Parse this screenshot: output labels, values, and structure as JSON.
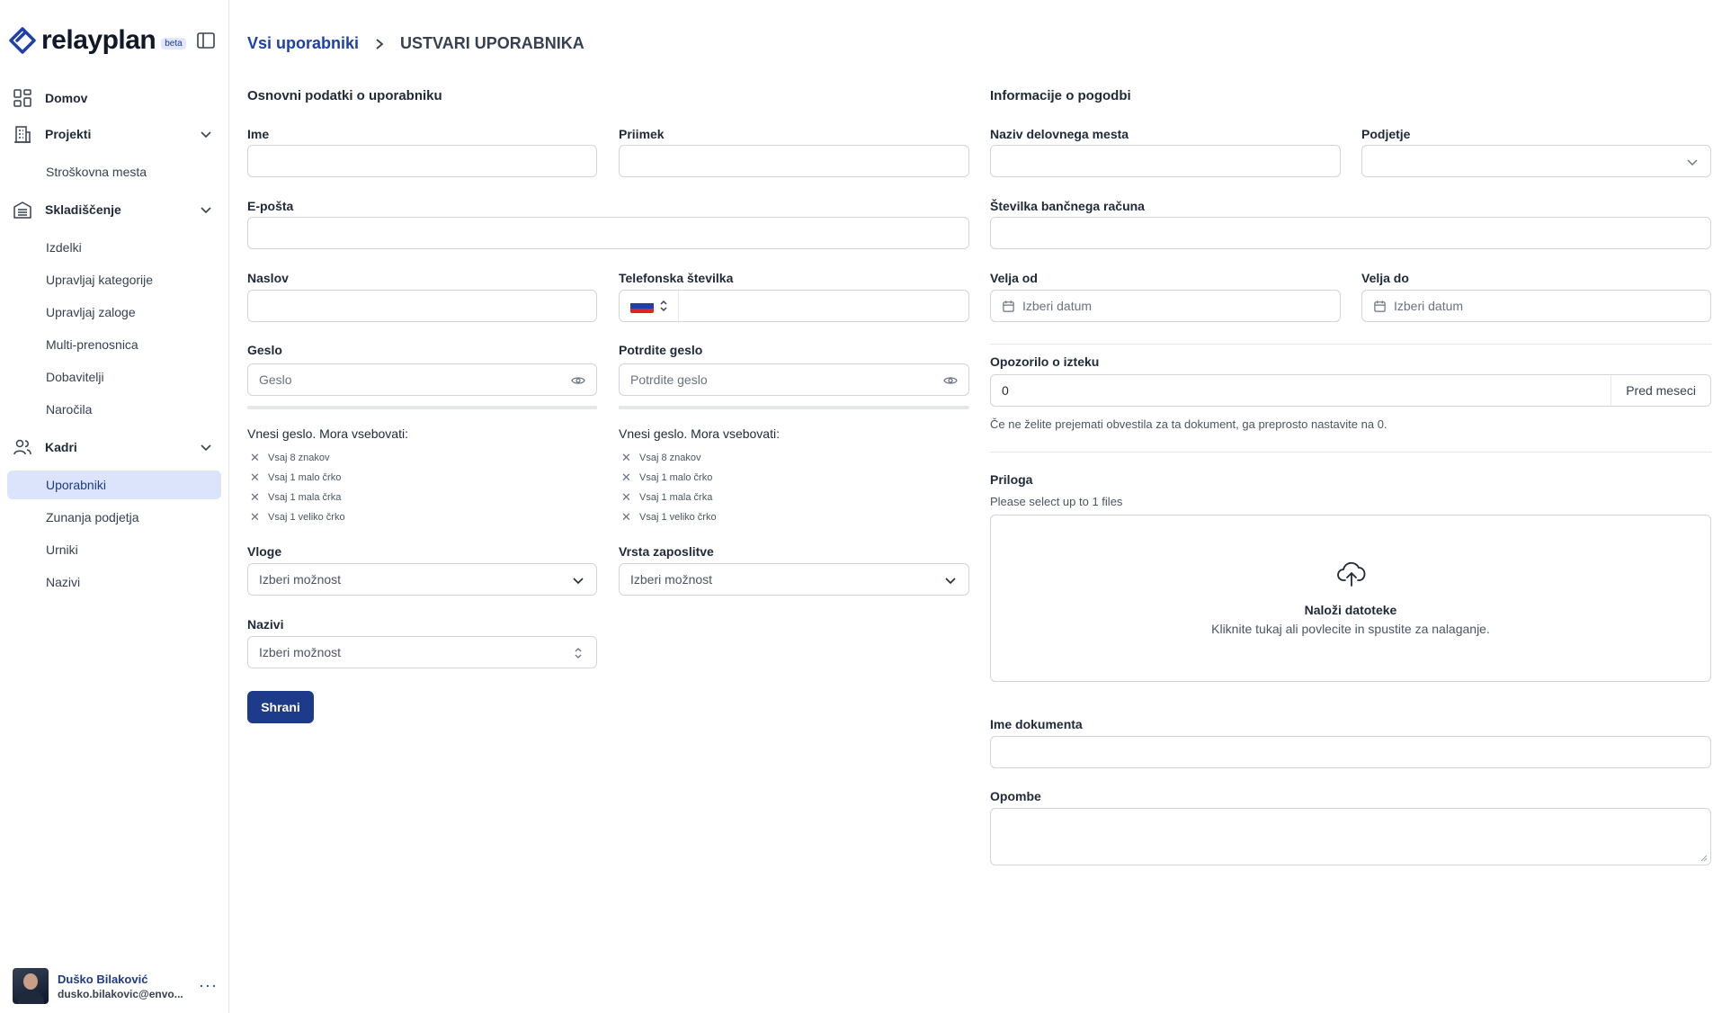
{
  "app": {
    "name": "relayplan",
    "badge": "beta"
  },
  "sidebar": {
    "groups": [
      {
        "label": "Domov",
        "items": []
      },
      {
        "label": "Projekti",
        "items": [
          "Stroškovna mesta"
        ]
      },
      {
        "label": "Skladiščenje",
        "items": [
          "Izdelki",
          "Upravljaj kategorije",
          "Upravljaj zaloge",
          "Multi-prenosnica",
          "Dobavitelji",
          "Naročila"
        ]
      },
      {
        "label": "Kadri",
        "items": [
          "Uporabniki",
          "Zunanja podjetja",
          "Urniki",
          "Nazivi"
        ]
      }
    ],
    "active_item": "Uporabniki",
    "user": {
      "name": "Duško Bilaković",
      "email": "dusko.bilakovic@envo..."
    }
  },
  "breadcrumb": {
    "link": "Vsi uporabniki",
    "current": "USTVARI UPORABNIKA"
  },
  "basic": {
    "title": "Osnovni podatki o uporabniku",
    "first_name_label": "Ime",
    "last_name_label": "Priimek",
    "email_label": "E-pošta",
    "address_label": "Naslov",
    "phone_label": "Telefonska številka",
    "password_label": "Geslo",
    "password_placeholder": "Geslo",
    "confirm_label": "Potrdite geslo",
    "confirm_placeholder": "Potrdite geslo",
    "requirements_title": "Vnesi geslo. Mora vsebovati:",
    "requirements": [
      "Vsaj 8 znakov",
      "Vsaj 1 malo črko",
      "Vsaj 1 mala črka",
      "Vsaj 1 veliko črko"
    ],
    "roles_label": "Vloge",
    "employment_label": "Vrsta zaposlitve",
    "titles_label": "Nazivi",
    "select_placeholder": "Izberi možnost",
    "save_label": "Shrani"
  },
  "contract": {
    "title": "Informacije o pogodbi",
    "job_title_label": "Naziv delovnega mesta",
    "company_label": "Podjetje",
    "bank_label": "Številka bančnega računa",
    "valid_from_label": "Velja od",
    "valid_to_label": "Velja do",
    "date_placeholder": "Izberi datum",
    "expiry_label": "Opozorilo o izteku",
    "expiry_value": "0",
    "expiry_suffix": "Pred meseci",
    "expiry_hint": "Če ne želite prejemati obvestila za ta dokument, ga preprosto nastavite na 0.",
    "attachment_label": "Priloga",
    "attachment_hint": "Please select up to 1 files",
    "upload_title": "Naloži datoteke",
    "upload_sub": "Kliknite tukaj ali povlecite in spustite za nalaganje.",
    "doc_name_label": "Ime dokumenta",
    "notes_label": "Opombe"
  },
  "colors": {
    "accent": "#1e3a8a",
    "active_bg": "#dbe4fb",
    "border": "#d1d5db"
  }
}
